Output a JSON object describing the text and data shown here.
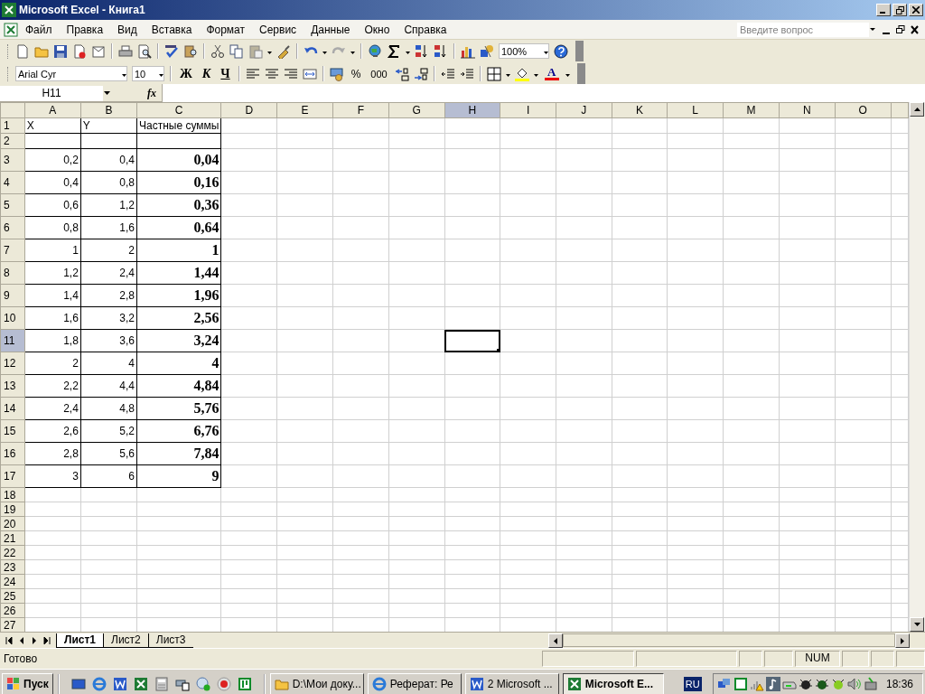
{
  "window": {
    "title": "Microsoft Excel - Книга1"
  },
  "menu": [
    {
      "label": "Файл"
    },
    {
      "label": "Правка"
    },
    {
      "label": "Вид"
    },
    {
      "label": "Вставка"
    },
    {
      "label": "Формат"
    },
    {
      "label": "Сервис"
    },
    {
      "label": "Данные"
    },
    {
      "label": "Окно"
    },
    {
      "label": "Справка"
    }
  ],
  "help_search": {
    "placeholder": "Введите вопрос"
  },
  "standard_toolbar": {
    "zoom": "100%"
  },
  "formatting_toolbar": {
    "font": "Arial Cyr",
    "size": "10",
    "bold": "Ж",
    "italic": "К",
    "underline": "Ч",
    "percent": "%",
    "thousands": "000",
    "font_color": "A"
  },
  "formula_bar": {
    "name_box": "H11",
    "function_label": "fx"
  },
  "table": {
    "columns": [
      {
        "label": "A",
        "selected": false
      },
      {
        "label": "B",
        "selected": false
      },
      {
        "label": "C",
        "selected": false
      },
      {
        "label": "D",
        "selected": false
      },
      {
        "label": "E",
        "selected": false
      },
      {
        "label": "F",
        "selected": false
      },
      {
        "label": "G",
        "selected": false
      },
      {
        "label": "H",
        "selected": true
      },
      {
        "label": "I",
        "selected": false
      },
      {
        "label": "J",
        "selected": false
      },
      {
        "label": "K",
        "selected": false
      },
      {
        "label": "L",
        "selected": false
      },
      {
        "label": "M",
        "selected": false
      },
      {
        "label": "N",
        "selected": false
      },
      {
        "label": "O",
        "selected": false
      }
    ],
    "rows": [
      {
        "label": "1",
        "selected": false,
        "kind": "heading",
        "cells": [
          "X",
          "Y",
          "Частные суммы"
        ]
      },
      {
        "label": "2",
        "selected": false,
        "kind": "blank"
      },
      {
        "label": "3",
        "selected": false,
        "kind": "data",
        "cells": [
          "0,2",
          "0,4",
          "0,04"
        ]
      },
      {
        "label": "4",
        "selected": false,
        "kind": "data",
        "cells": [
          "0,4",
          "0,8",
          "0,16"
        ]
      },
      {
        "label": "5",
        "selected": false,
        "kind": "data",
        "cells": [
          "0,6",
          "1,2",
          "0,36"
        ]
      },
      {
        "label": "6",
        "selected": false,
        "kind": "data",
        "cells": [
          "0,8",
          "1,6",
          "0,64"
        ]
      },
      {
        "label": "7",
        "selected": false,
        "kind": "data",
        "cells": [
          "1",
          "2",
          "1"
        ]
      },
      {
        "label": "8",
        "selected": false,
        "kind": "data",
        "cells": [
          "1,2",
          "2,4",
          "1,44"
        ]
      },
      {
        "label": "9",
        "selected": false,
        "kind": "data",
        "cells": [
          "1,4",
          "2,8",
          "1,96"
        ]
      },
      {
        "label": "10",
        "selected": false,
        "kind": "data",
        "cells": [
          "1,6",
          "3,2",
          "2,56"
        ]
      },
      {
        "label": "11",
        "selected": true,
        "kind": "data",
        "cells": [
          "1,8",
          "3,6",
          "3,24"
        ]
      },
      {
        "label": "12",
        "selected": false,
        "kind": "data",
        "cells": [
          "2",
          "4",
          "4"
        ]
      },
      {
        "label": "13",
        "selected": false,
        "kind": "data",
        "cells": [
          "2,2",
          "4,4",
          "4,84"
        ]
      },
      {
        "label": "14",
        "selected": false,
        "kind": "data",
        "cells": [
          "2,4",
          "4,8",
          "5,76"
        ]
      },
      {
        "label": "15",
        "selected": false,
        "kind": "data",
        "cells": [
          "2,6",
          "5,2",
          "6,76"
        ]
      },
      {
        "label": "16",
        "selected": false,
        "kind": "data",
        "cells": [
          "2,8",
          "5,6",
          "7,84"
        ]
      },
      {
        "label": "17",
        "selected": false,
        "kind": "data",
        "cells": [
          "3",
          "6",
          "9"
        ]
      },
      {
        "label": "18",
        "selected": false,
        "kind": "empty"
      },
      {
        "label": "19",
        "selected": false,
        "kind": "empty"
      },
      {
        "label": "20",
        "selected": false,
        "kind": "empty"
      },
      {
        "label": "21",
        "selected": false,
        "kind": "empty"
      },
      {
        "label": "22",
        "selected": false,
        "kind": "empty"
      },
      {
        "label": "23",
        "selected": false,
        "kind": "empty"
      },
      {
        "label": "24",
        "selected": false,
        "kind": "empty"
      },
      {
        "label": "25",
        "selected": false,
        "kind": "empty"
      },
      {
        "label": "26",
        "selected": false,
        "kind": "empty"
      },
      {
        "label": "27",
        "selected": false,
        "kind": "empty"
      }
    ]
  },
  "sheet_tabs": [
    {
      "label": "Лист1",
      "selected": true
    },
    {
      "label": "Лист2",
      "selected": false
    },
    {
      "label": "Лист3",
      "selected": false
    }
  ],
  "status_bar": {
    "mode": "Готово",
    "num": "NUM"
  },
  "taskbar": {
    "start": "Пуск",
    "tasks": [
      {
        "label": "D:\\Мои доку...",
        "selected": false,
        "kind": "folder"
      },
      {
        "label": "Реферат: Ре",
        "selected": false,
        "kind": "browser"
      },
      {
        "label": "2 Microsoft ...",
        "selected": false,
        "kind": "word"
      },
      {
        "label": "Microsoft E...",
        "selected": true,
        "kind": "excel"
      }
    ],
    "language": "RU",
    "clock": "18:36"
  }
}
